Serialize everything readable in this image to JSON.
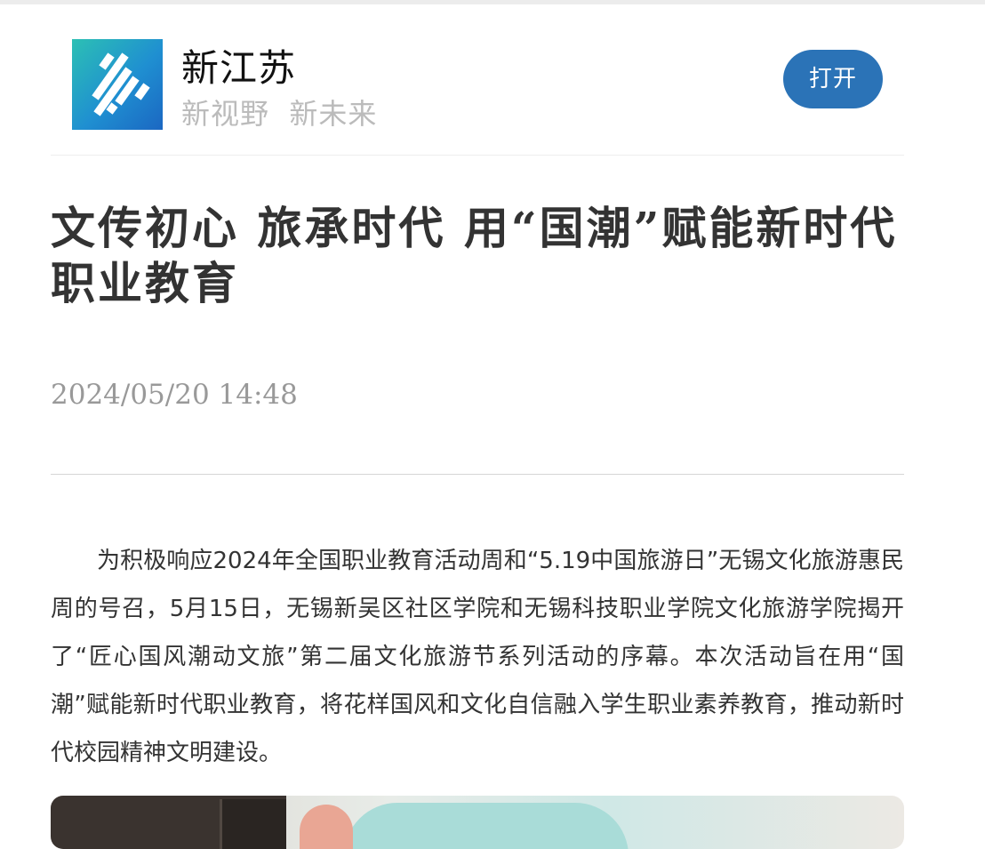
{
  "app": {
    "name": "新江苏",
    "slogan": "新视野  新未来",
    "open_button_label": "打开",
    "logo_icon": "xinjiangsu-logo-icon",
    "accent_color": "#2b73b7"
  },
  "article": {
    "title": "文传初心 旅承时代 用“国潮”赋能新时代职业教育",
    "publish_time": "2024/05/20 14:48",
    "paragraphs": [
      "为积极响应2024年全国职业教育活动周和“5.19中国旅游日”无锡文化旅游惠民周的号召，5月15日，无锡新吴区社区学院和无锡科技职业学院文化旅游学院揭开了“匠心国风潮动文旅”第二届文化旅游节系列活动的序幕。本次活动旨在用“国潮”赋能新时代职业教育，将花样国风和文化自信融入学生职业素养教育，推动新时代校园精神文明建设。"
    ]
  }
}
